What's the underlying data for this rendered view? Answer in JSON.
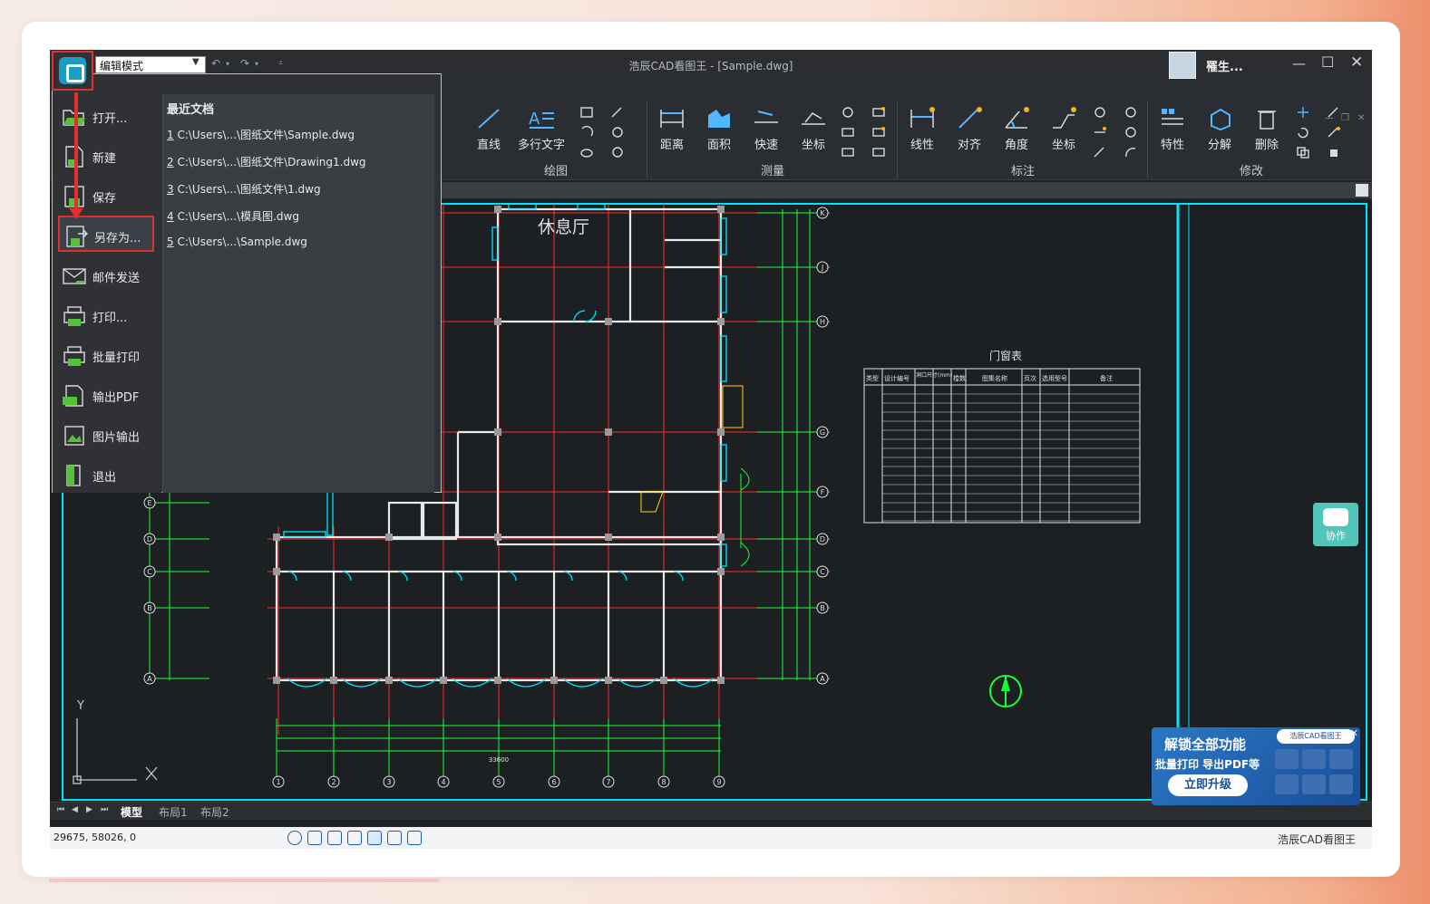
{
  "window": {
    "title": "浩辰CAD看图王 - [Sample.dwg]",
    "mode_value": "编辑模式",
    "user_name": "罹生..."
  },
  "ribbon": {
    "groups": [
      {
        "label": "绘图",
        "buttons": [
          "直线",
          "多行文字"
        ]
      },
      {
        "label": "测量",
        "buttons": [
          "距离",
          "面积",
          "快速",
          "坐标"
        ]
      },
      {
        "label": "标注",
        "buttons": [
          "线性",
          "对齐",
          "角度",
          "坐标"
        ]
      },
      {
        "label": "修改",
        "buttons": [
          "特性",
          "分解",
          "删除"
        ]
      }
    ]
  },
  "file_menu": {
    "items": [
      "打开...",
      "新建",
      "保存",
      "另存为...",
      "邮件发送",
      "打印...",
      "批量打印",
      "输出PDF",
      "图片输出",
      "退出"
    ],
    "active_item": "另存为...",
    "recent_title": "最近文档",
    "recent": [
      {
        "num": "1",
        "path": "C:\\Users\\...\\图纸文件\\Sample.dwg"
      },
      {
        "num": "2",
        "path": "C:\\Users\\...\\图纸文件\\Drawing1.dwg"
      },
      {
        "num": "3",
        "path": "C:\\Users\\...\\图纸文件\\1.dwg"
      },
      {
        "num": "4",
        "path": "C:\\Users\\...\\模具图.dwg"
      },
      {
        "num": "5",
        "path": "C:\\Users\\...\\Sample.dwg"
      }
    ]
  },
  "drawing": {
    "room_label": "休息厅",
    "table_title": "门窗表",
    "table_headers": [
      "类型",
      "设计编号",
      "洞口尺寸(mm)",
      "樘数",
      "图集名称",
      "页次",
      "选用型号",
      "备注"
    ],
    "axis_letters": [
      "K",
      "J",
      "H",
      "G",
      "F",
      "D",
      "C",
      "B",
      "A"
    ],
    "left_axis_letters": [
      "E",
      "D",
      "C",
      "B",
      "A"
    ],
    "bottom_axis_numbers": [
      "1",
      "2",
      "3",
      "4",
      "5",
      "6",
      "7",
      "8",
      "9"
    ],
    "bottom_total": "33600",
    "ucs_x": "X",
    "ucs_y": "Y"
  },
  "layout_tabs": [
    "模型",
    "布局1",
    "布局2"
  ],
  "active_layout": "模型",
  "status": {
    "coords": "29675, 58026, 0",
    "brand": "浩辰CAD看图王"
  },
  "collab": {
    "label": "协作"
  },
  "promo": {
    "line1": "解锁全部功能",
    "line2": "批量打印 导出PDF等",
    "cta": "立即升级",
    "brand_tag": "浩辰CAD看图王"
  },
  "colors": {
    "accent_red": "#e03030",
    "cad_red": "#ff2a2a",
    "cad_cyan": "#00e5ff",
    "cad_green": "#17ff36",
    "background": "#1c2022"
  }
}
